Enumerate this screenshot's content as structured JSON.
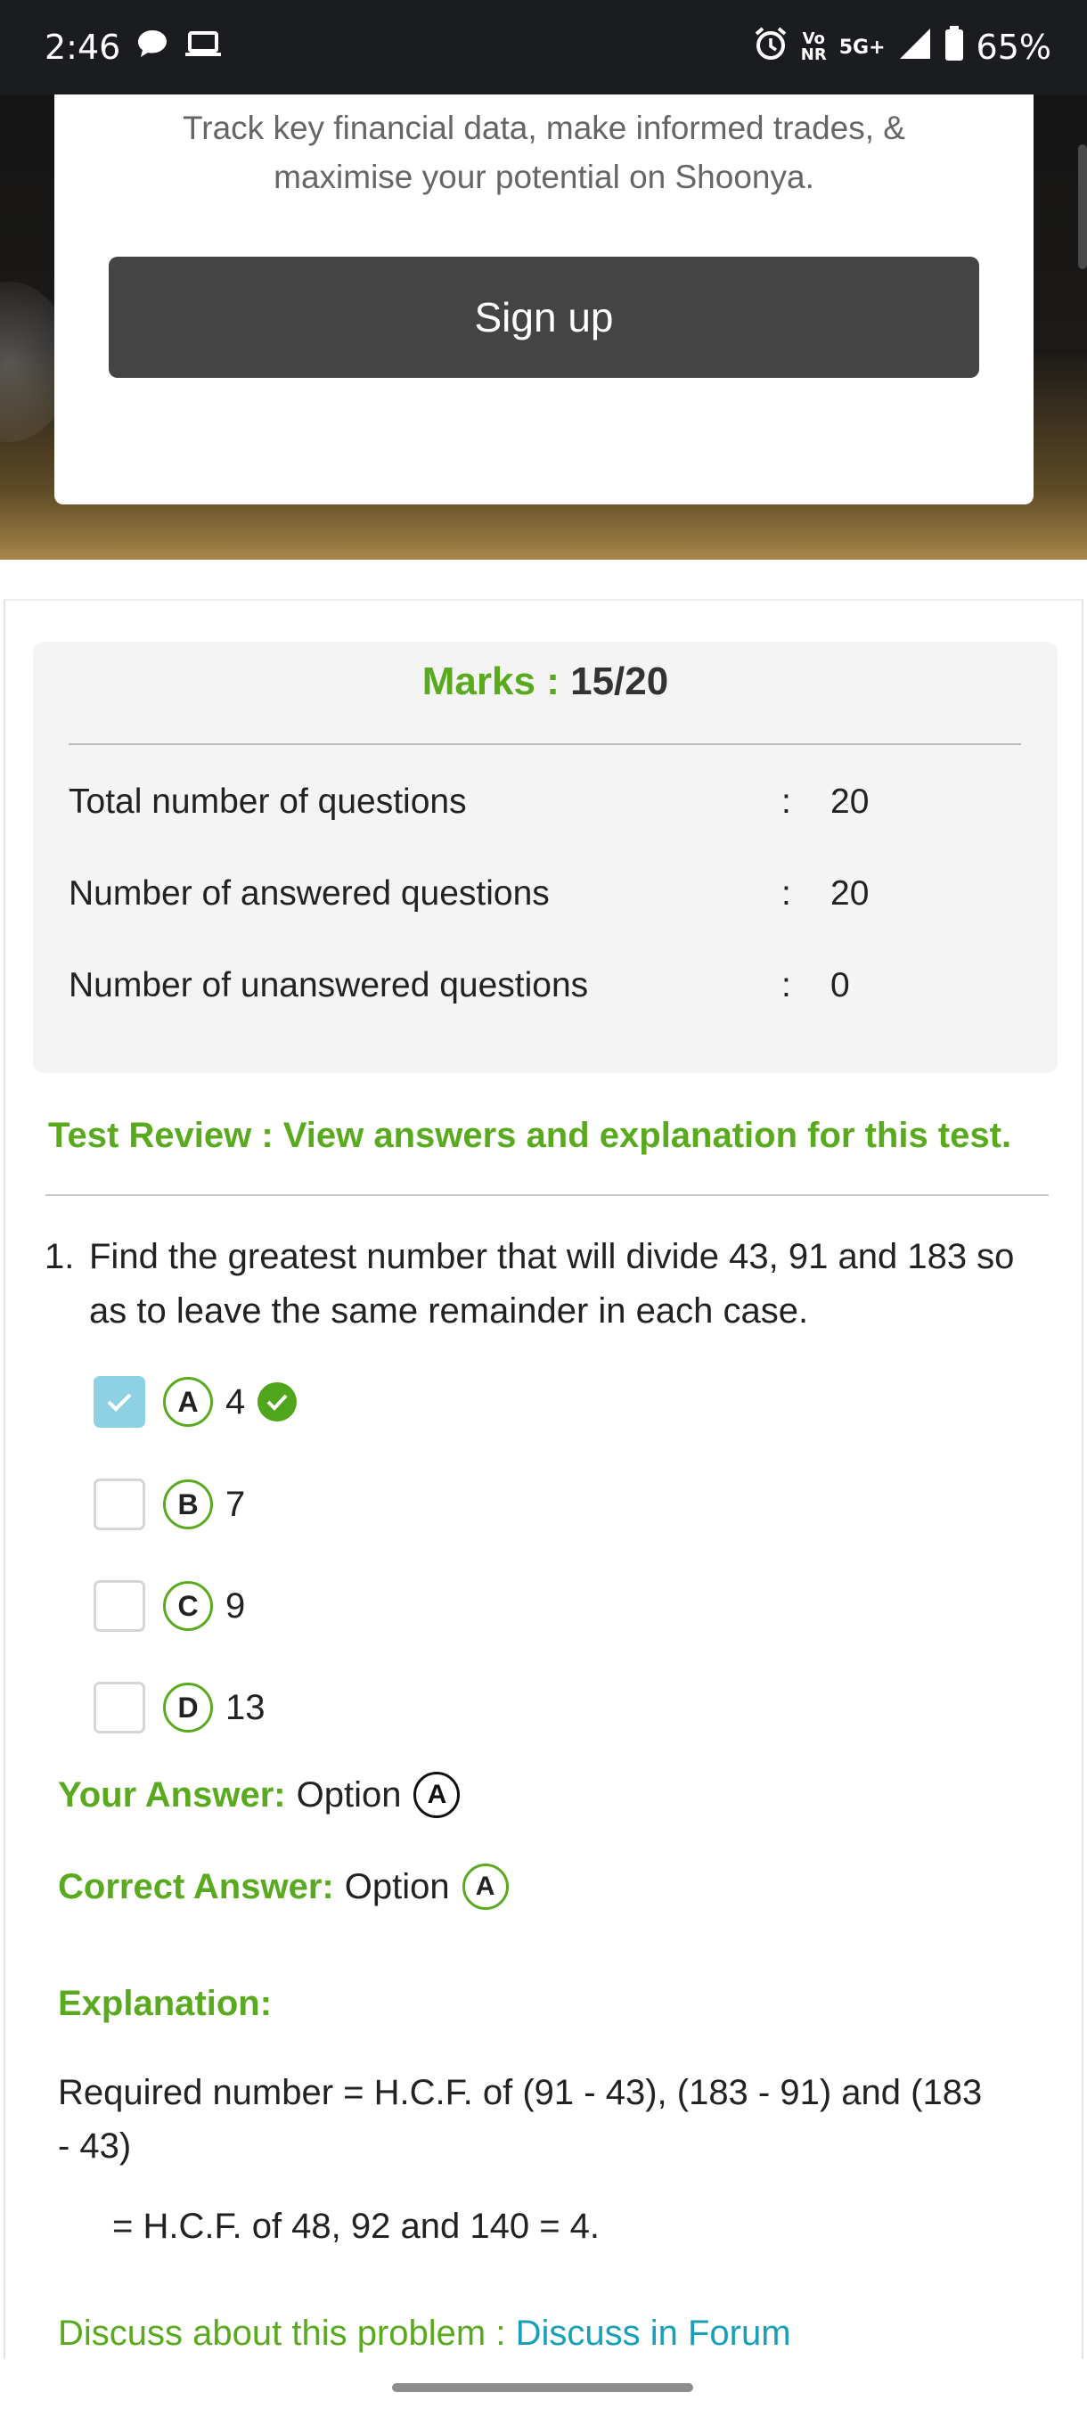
{
  "status_bar": {
    "time": "2:46",
    "vo_label": "Vo",
    "nr_label": "NR",
    "network": "5G+",
    "battery": "65%"
  },
  "ad": {
    "description": "Track key financial data, make informed trades, & maximise your potential on Shoonya.",
    "signup_label": "Sign up"
  },
  "summary": {
    "marks_label": "Marks :",
    "marks_value": "15/20",
    "rows": [
      {
        "label": "Total number of questions",
        "colon": ":",
        "value": "20"
      },
      {
        "label": "Number of answered questions",
        "colon": ":",
        "value": "20"
      },
      {
        "label": "Number of unanswered questions",
        "colon": ":",
        "value": "0"
      }
    ]
  },
  "review_link": "Test Review : View answers and explanation for this test.",
  "question": {
    "number": "1.",
    "text": "Find the greatest number that will divide 43, 91 and 183 so as to leave the same remainder in each case.",
    "options": [
      {
        "letter": "A",
        "text": "4",
        "checked": true,
        "correct": true
      },
      {
        "letter": "B",
        "text": "7",
        "checked": false,
        "correct": false
      },
      {
        "letter": "C",
        "text": "9",
        "checked": false,
        "correct": false
      },
      {
        "letter": "D",
        "text": "13",
        "checked": false,
        "correct": false
      }
    ],
    "your_answer_label": "Your Answer:",
    "your_answer_text": "Option",
    "your_answer_letter": "A",
    "correct_answer_label": "Correct Answer:",
    "correct_answer_text": "Option",
    "correct_answer_letter": "A",
    "explanation_label": "Explanation:",
    "explanation_line1": "Required number = H.C.F. of (91 - 43), (183 - 91) and (183 - 43)",
    "explanation_line2": "= H.C.F. of 48, 92 and 140 = 4.",
    "discuss_prefix": "Discuss about this problem :",
    "discuss_link": "Discuss in Forum"
  },
  "colors": {
    "accent_green": "#5aaa1f",
    "link_teal": "#19a0b8",
    "checkbox_checked": "#8fd1e4"
  }
}
